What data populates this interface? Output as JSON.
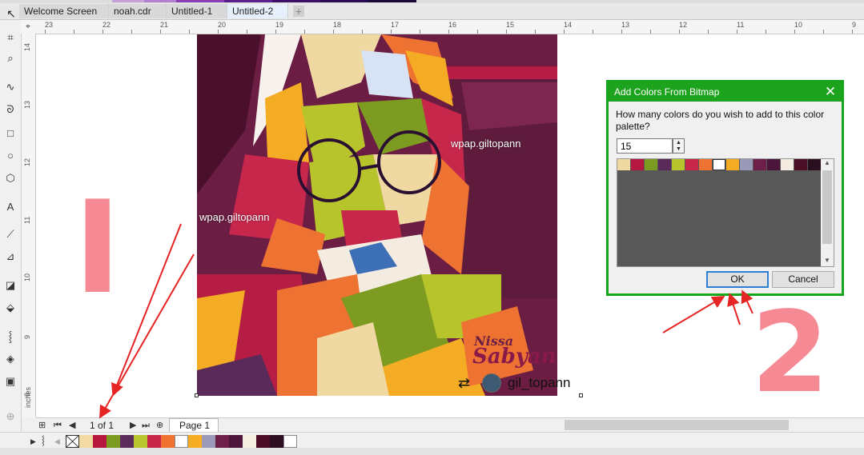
{
  "tabs": [
    "Welcome Screen",
    "noah.cdr",
    "Untitled-1",
    "Untitled-2"
  ],
  "active_tab": "Untitled-2",
  "ruler": {
    "horizontal_numbers": [
      "23",
      "22",
      "21",
      "20",
      "19",
      "18",
      "17",
      "16",
      "15",
      "14",
      "13",
      "12",
      "11",
      "10",
      "9"
    ],
    "vertical_numbers": [
      "14",
      "13",
      "12",
      "11",
      "10",
      "9",
      "8"
    ],
    "units": "inches"
  },
  "artwork": {
    "watermark_left": "wpap.giltopann",
    "watermark_right": "wpap.giltopann",
    "title_small": "Nissa",
    "title_big": "Sabyan",
    "handle": "gil_topann"
  },
  "dialog": {
    "title": "Add Colors From Bitmap",
    "question": "How many colors do you wish to add to this color palette?",
    "count": "15",
    "ok_label": "OK",
    "cancel_label": "Cancel",
    "swatches": [
      "#f0d8a3",
      "#b4173f",
      "#7a9a22",
      "#5a2a5a",
      "#b8c42b",
      "#c6274b",
      "#ee7231",
      "#ffffff",
      "#f5ac25",
      "#9a9ab8",
      "#6e1f4a",
      "#4a173a",
      "#f4ece0",
      "#4b0f26",
      "#2a0f1e"
    ]
  },
  "pagebar": {
    "page_count": "1 of 1",
    "page_tab": "Page 1"
  },
  "palette_swatches": [
    "#f3d9a4",
    "#b5173e",
    "#7c9b20",
    "#5c2c5c",
    "#b9c52c",
    "#c8264b",
    "#ef7232",
    "#ffffff",
    "#f6ad24",
    "#9b9bb9",
    "#6f2049",
    "#4b1639",
    "#f4ede1",
    "#4c0e25",
    "#2b0e1f",
    "#ffffff"
  ],
  "annotations": {
    "first": "I",
    "second": "2"
  },
  "colors": {
    "dialog_accent": "#1ea31f",
    "annotation": "#f58a94",
    "arrow": "#e52424"
  }
}
